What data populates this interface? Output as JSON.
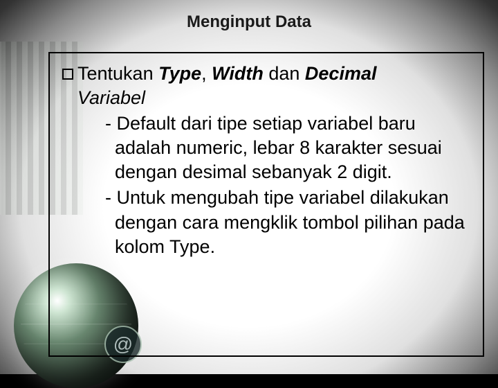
{
  "title": "Menginput Data",
  "bullet": {
    "lead": "Tentukan ",
    "term1": "Type",
    "sep1": ", ",
    "term2": "Width",
    "mid": " dan ",
    "term3": "Decimal",
    "line2": "Variabel",
    "sub1": "- Default dari tipe setiap variabel baru adalah numeric, lebar 8 karakter sesuai dengan desimal sebanyak 2 digit.",
    "sub2": "- Untuk mengubah tipe variabel dilakukan dengan cara mengklik tombol pilihan pada kolom Type."
  }
}
